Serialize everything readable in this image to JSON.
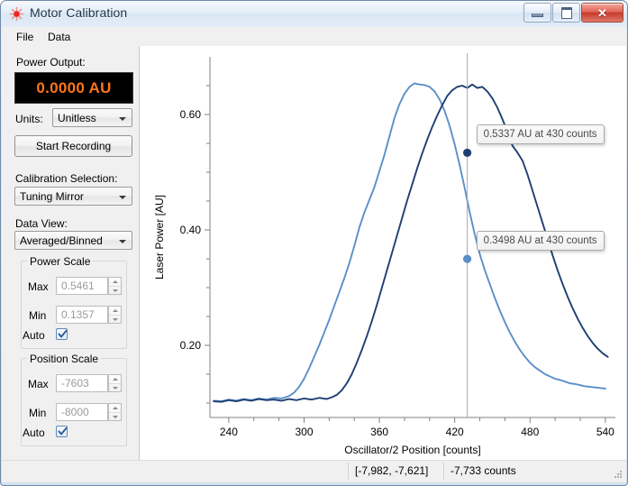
{
  "window": {
    "title": "Motor Calibration",
    "icon": "laser-burst-icon",
    "minimize_label": "Minimize",
    "maximize_label": "Maximize",
    "close_label": "Close"
  },
  "menu": {
    "items": [
      {
        "label": "File"
      },
      {
        "label": "Data"
      }
    ]
  },
  "left_panel": {
    "power_output_label": "Power Output:",
    "power_output_value": "0.0000 AU",
    "power_output_color": "#ff7518",
    "units_label": "Units:",
    "units_value": "Unitless",
    "record_button": "Start Recording",
    "calibration_label": "Calibration Selection:",
    "calibration_value": "Tuning Mirror",
    "data_view_label": "Data View:",
    "data_view_value": "Averaged/Binned",
    "power_scale": {
      "title": "Power Scale",
      "max_label": "Max",
      "max_value": "0.5461",
      "min_label": "Min",
      "min_value": "0.1357",
      "auto_label": "Auto",
      "auto_checked": true
    },
    "position_scale": {
      "title": "Position Scale",
      "max_label": "Max",
      "max_value": "-7603",
      "min_label": "Min",
      "min_value": "-8000",
      "auto_label": "Auto",
      "auto_checked": true
    }
  },
  "status_bar": {
    "range": "[-7,982, -7,621]",
    "position": "-7,733 counts"
  },
  "chart_data": {
    "type": "line",
    "title": "",
    "xlabel": "Oscillator/2 Position [counts]",
    "ylabel": "Laser Power [AU]",
    "xlim": [
      225,
      548
    ],
    "ylim": [
      0.075,
      0.7
    ],
    "xticks": [
      240,
      300,
      360,
      420,
      480,
      540
    ],
    "yticks": [
      0.2,
      0.4,
      0.6
    ],
    "ytick_labels": [
      "0.20",
      "0.40",
      "0.60"
    ],
    "xtick_labels": [
      "240",
      "300",
      "360",
      "420",
      "480",
      "540"
    ],
    "minor_ticks": true,
    "grid": false,
    "legend": "none",
    "cursor": {
      "x": 430,
      "label": "430 counts",
      "color": "#a9a9a9"
    },
    "annotations": [
      {
        "text": "0.5337 AU at 430 counts",
        "x": 430,
        "y": 0.5337,
        "series": "dark"
      },
      {
        "text": "0.3498 AU at 430 counts",
        "x": 430,
        "y": 0.3498,
        "series": "light"
      }
    ],
    "series": [
      {
        "name": "light",
        "color": "#5b8fc9",
        "x": [
          228,
          234,
          240,
          246,
          252,
          258,
          264,
          270,
          276,
          282,
          288,
          292,
          296,
          300,
          304,
          308,
          312,
          316,
          320,
          324,
          328,
          332,
          336,
          340,
          344,
          348,
          352,
          356,
          360,
          364,
          368,
          372,
          376,
          380,
          384,
          388,
          392,
          396,
          400,
          404,
          408,
          412,
          416,
          420,
          424,
          428,
          432,
          436,
          440,
          444,
          448,
          452,
          456,
          460,
          464,
          468,
          472,
          476,
          480,
          484,
          488,
          492,
          496,
          500,
          504,
          508,
          512,
          516,
          520,
          524,
          528,
          532,
          536,
          540
        ],
        "y": [
          0.104,
          0.103,
          0.106,
          0.104,
          0.107,
          0.105,
          0.108,
          0.106,
          0.109,
          0.108,
          0.112,
          0.118,
          0.128,
          0.142,
          0.16,
          0.18,
          0.2,
          0.222,
          0.244,
          0.268,
          0.292,
          0.316,
          0.342,
          0.372,
          0.404,
          0.43,
          0.452,
          0.474,
          0.502,
          0.53,
          0.562,
          0.594,
          0.618,
          0.636,
          0.648,
          0.654,
          0.652,
          0.651,
          0.648,
          0.64,
          0.626,
          0.606,
          0.58,
          0.548,
          0.512,
          0.472,
          0.43,
          0.392,
          0.358,
          0.33,
          0.306,
          0.282,
          0.26,
          0.24,
          0.222,
          0.206,
          0.192,
          0.18,
          0.17,
          0.162,
          0.156,
          0.15,
          0.146,
          0.142,
          0.14,
          0.137,
          0.134,
          0.133,
          0.131,
          0.129,
          0.128,
          0.127,
          0.126,
          0.125
        ]
      },
      {
        "name": "dark",
        "color": "#1f3f73",
        "x": [
          228,
          234,
          240,
          246,
          252,
          258,
          264,
          270,
          276,
          282,
          288,
          294,
          300,
          306,
          312,
          318,
          322,
          326,
          330,
          334,
          338,
          342,
          346,
          350,
          354,
          358,
          362,
          366,
          370,
          374,
          378,
          382,
          386,
          390,
          394,
          398,
          402,
          406,
          410,
          414,
          418,
          422,
          426,
          430,
          434,
          438,
          442,
          446,
          450,
          454,
          458,
          462,
          466,
          470,
          474,
          478,
          482,
          486,
          490,
          494,
          498,
          502,
          506,
          510,
          514,
          518,
          522,
          526,
          530,
          534,
          538,
          542
        ],
        "y": [
          0.103,
          0.102,
          0.105,
          0.103,
          0.106,
          0.104,
          0.107,
          0.105,
          0.106,
          0.104,
          0.107,
          0.105,
          0.108,
          0.106,
          0.109,
          0.107,
          0.11,
          0.114,
          0.122,
          0.134,
          0.15,
          0.17,
          0.192,
          0.216,
          0.242,
          0.27,
          0.3,
          0.33,
          0.36,
          0.39,
          0.42,
          0.45,
          0.478,
          0.506,
          0.532,
          0.556,
          0.578,
          0.598,
          0.616,
          0.632,
          0.642,
          0.648,
          0.65,
          0.646,
          0.652,
          0.646,
          0.648,
          0.64,
          0.628,
          0.612,
          0.592,
          0.57,
          0.546,
          0.534,
          0.52,
          0.496,
          0.468,
          0.44,
          0.412,
          0.384,
          0.356,
          0.33,
          0.306,
          0.284,
          0.264,
          0.246,
          0.23,
          0.216,
          0.204,
          0.194,
          0.186,
          0.18
        ]
      }
    ]
  }
}
